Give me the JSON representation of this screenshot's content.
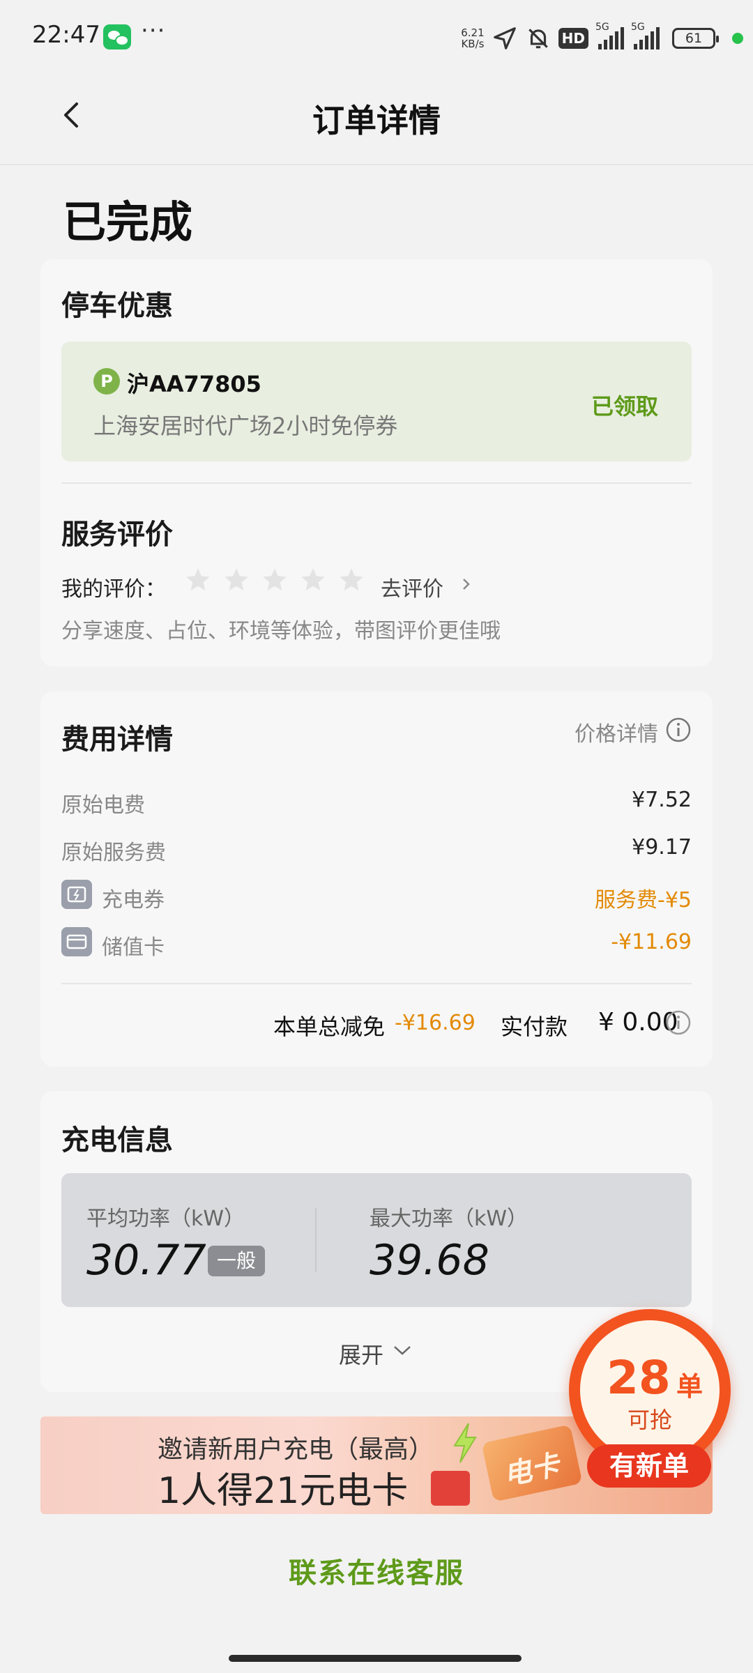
{
  "status_bar": {
    "time": "22:47",
    "more": "···",
    "net_speed_value": "6.21",
    "net_speed_unit": "KB/s",
    "hd_badge": "HD",
    "sim1_label": "5G",
    "sim2_label": "5G",
    "battery": "61"
  },
  "nav": {
    "title": "订单详情"
  },
  "order": {
    "status": "已完成"
  },
  "parking": {
    "title": "停车优惠",
    "p_letter": "P",
    "plate": "沪AA77805",
    "coupon_desc": "上海安居时代广场2小时免停券",
    "claimed_label": "已领取"
  },
  "review": {
    "title": "服务评价",
    "my_rating_label": "我的评价：",
    "rating": 0,
    "max_rating": 5,
    "go_rate_label": "去评价",
    "hint": "分享速度、占位、环境等体验，带图评价更佳哦"
  },
  "fees": {
    "title": "费用详情",
    "price_detail_label": "价格详情",
    "rows": [
      {
        "label": "原始电费",
        "value": "¥7.52"
      },
      {
        "label": "原始服务费",
        "value": "¥9.17"
      },
      {
        "label": "充电券",
        "value": "服务费-¥5"
      },
      {
        "label": "储值卡",
        "value": "-¥11.69"
      }
    ],
    "total_reduce_label": "本单总减免",
    "total_reduce_value": "-¥16.69",
    "paid_label": "实付款",
    "paid_value": "¥ 0.00"
  },
  "charging": {
    "title": "充电信息",
    "avg_power_label": "平均功率（kW）",
    "avg_power_value": "30.77",
    "avg_power_badge": "一般",
    "max_power_label": "最大功率（kW）",
    "max_power_value": "39.68",
    "expand_label": "展开"
  },
  "banner": {
    "line1": "邀请新用户充电（最高）",
    "line2": "1人得21元电卡",
    "card_text": "电卡"
  },
  "grab_badge": {
    "count": "28",
    "unit": "单",
    "label": "可抢",
    "new_label": "有新单"
  },
  "footer": {
    "contact_label": "联系在线客服"
  },
  "colors": {
    "accent_green": "#5e9a1a",
    "orange": "#e38a06",
    "badge_red": "#f2531f"
  }
}
